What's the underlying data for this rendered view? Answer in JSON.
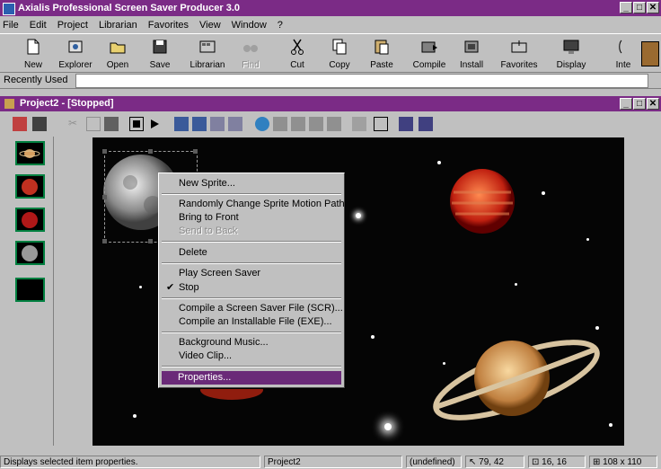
{
  "app": {
    "title": "Axialis Professional Screen Saver Producer 3.0",
    "window_buttons": [
      "_",
      "□",
      "✕"
    ]
  },
  "menubar": [
    "File",
    "Edit",
    "Project",
    "Librarian",
    "Favorites",
    "View",
    "Window",
    "?"
  ],
  "toolbar": [
    {
      "label": "New",
      "icon": "new-file-icon"
    },
    {
      "label": "Explorer",
      "icon": "explorer-icon"
    },
    {
      "label": "Open",
      "icon": "open-folder-icon"
    },
    {
      "label": "Save",
      "icon": "save-disk-icon"
    },
    {
      "label": "Librarian",
      "icon": "librarian-icon"
    },
    {
      "label": "Find",
      "icon": "binoculars-icon",
      "disabled": true
    },
    {
      "label": "Cut",
      "icon": "scissors-icon"
    },
    {
      "label": "Copy",
      "icon": "copy-icon"
    },
    {
      "label": "Paste",
      "icon": "paste-icon"
    },
    {
      "label": "Compile",
      "icon": "compile-icon"
    },
    {
      "label": "Install",
      "icon": "install-icon"
    },
    {
      "label": "Favorites",
      "icon": "favorites-icon"
    },
    {
      "label": "Display",
      "icon": "monitor-icon"
    },
    {
      "label": "Inte",
      "icon": "internet-icon"
    }
  ],
  "recent": {
    "label": "Recently Used",
    "value": ""
  },
  "project_window": {
    "title": "Project2 - [Stopped]"
  },
  "context_menu": {
    "items": [
      {
        "label": "New Sprite...",
        "disabled": false
      },
      {
        "label": "Randomly Change Sprite Motion Path",
        "disabled": false
      },
      {
        "label": "Bring to Front",
        "disabled": false
      },
      {
        "label": "Send to Back",
        "disabled": true
      },
      {
        "label": "Delete",
        "disabled": false
      },
      {
        "label": "Play Screen Saver",
        "disabled": false
      },
      {
        "label": "Stop",
        "disabled": false,
        "checked": true
      },
      {
        "label": "Compile a Screen Saver File (SCR)...",
        "disabled": false
      },
      {
        "label": "Compile an Installable File (EXE)...",
        "disabled": false
      },
      {
        "label": "Background Music...",
        "disabled": false
      },
      {
        "label": "Video Clip...",
        "disabled": false
      },
      {
        "label": "Properties...",
        "disabled": false,
        "selected": true
      }
    ]
  },
  "status": {
    "message": "Displays selected item properties.",
    "project": "Project2",
    "item": "(undefined)",
    "cursor": "79, 42",
    "position": "16, 16",
    "size": "108 x 110"
  },
  "colors": {
    "title_bar": "#7b2b86",
    "menu_highlight": "#6a2a78",
    "thumb_border": "#008040"
  }
}
